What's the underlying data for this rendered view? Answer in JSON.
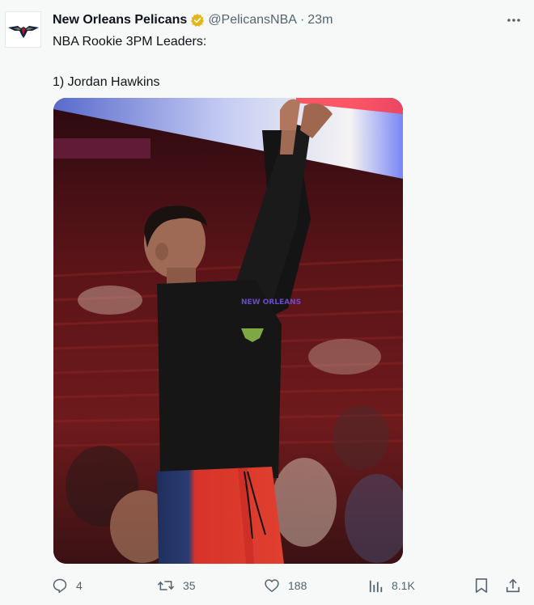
{
  "tweet": {
    "display_name": "New Orleans Pelicans",
    "handle": "@PelicansNBA",
    "separator": "·",
    "time": "23m",
    "text_line1": "NBA Rookie 3PM Leaders:",
    "text_line2": "1) Jordan Hawkins"
  },
  "media": {
    "jersey_lettering": "NEW ORLEANS"
  },
  "actions": {
    "replies": "4",
    "reposts": "35",
    "likes": "188",
    "views": "8.1K"
  },
  "colors": {
    "secondary_text": "#536471",
    "verified_gold": "#e2b719",
    "background": "#f7f9f9"
  },
  "icons": [
    "pelicans-logo-icon",
    "verified-badge-icon",
    "more-icon",
    "reply-icon",
    "repost-icon",
    "like-icon",
    "views-icon",
    "bookmark-icon",
    "share-icon"
  ]
}
